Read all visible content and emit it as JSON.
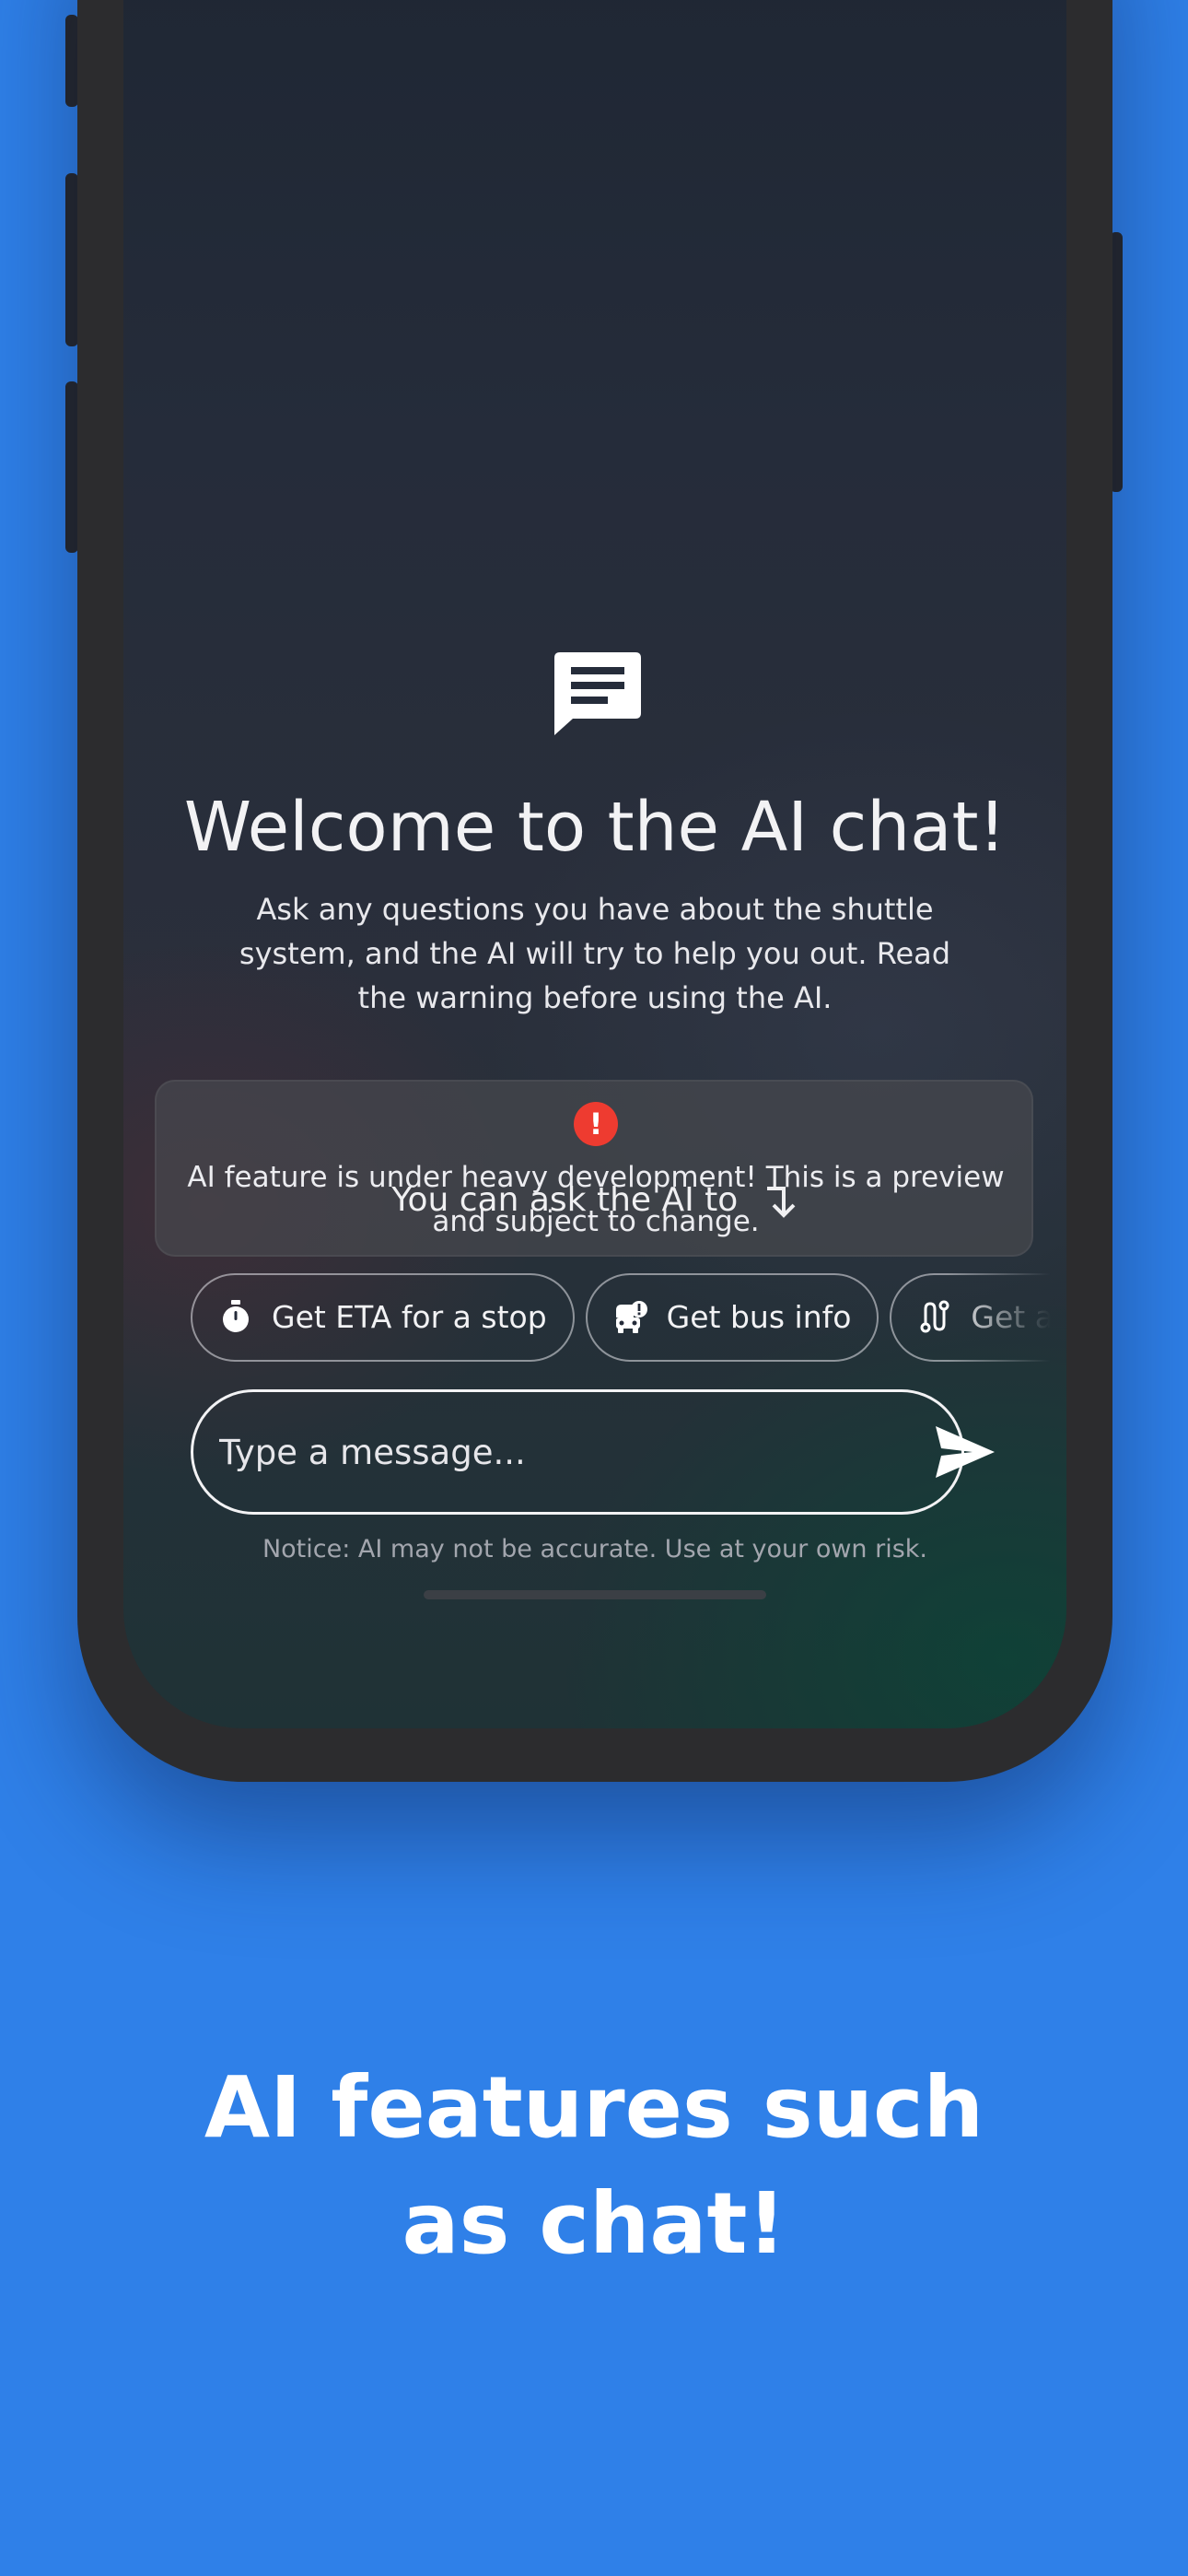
{
  "colors": {
    "background": "#2f80e8",
    "phone_frame": "#2c2c2e",
    "warning_red": "#ee3b30",
    "text_primary": "#f2f2f4",
    "notice_text": "#a3a6ae"
  },
  "chat": {
    "header_icon": "chat-bubble-icon",
    "title": "Welcome to the AI chat!",
    "description": "Ask any questions you have about the shuttle system, and the AI will try to help you out. Read the warning before using the AI.",
    "warning": {
      "icon": "exclamation-icon",
      "text": "AI feature is under heavy development! This is a preview and subject to change."
    },
    "ask_label": "You can ask the AI to",
    "ask_icon": "turn-down-arrow-icon",
    "suggestions": [
      {
        "icon": "stopwatch-icon",
        "label": "Get ETA for a stop"
      },
      {
        "icon": "bus-alert-icon",
        "label": "Get bus info"
      },
      {
        "icon": "route-icon",
        "label": "Get all stops"
      }
    ],
    "input": {
      "placeholder": "Type a message...",
      "value": ""
    },
    "send_icon": "send-icon",
    "notice": "Notice: AI may not be accurate. Use at your own risk."
  },
  "caption": {
    "line1": "AI features such",
    "line2": "as chat!"
  }
}
